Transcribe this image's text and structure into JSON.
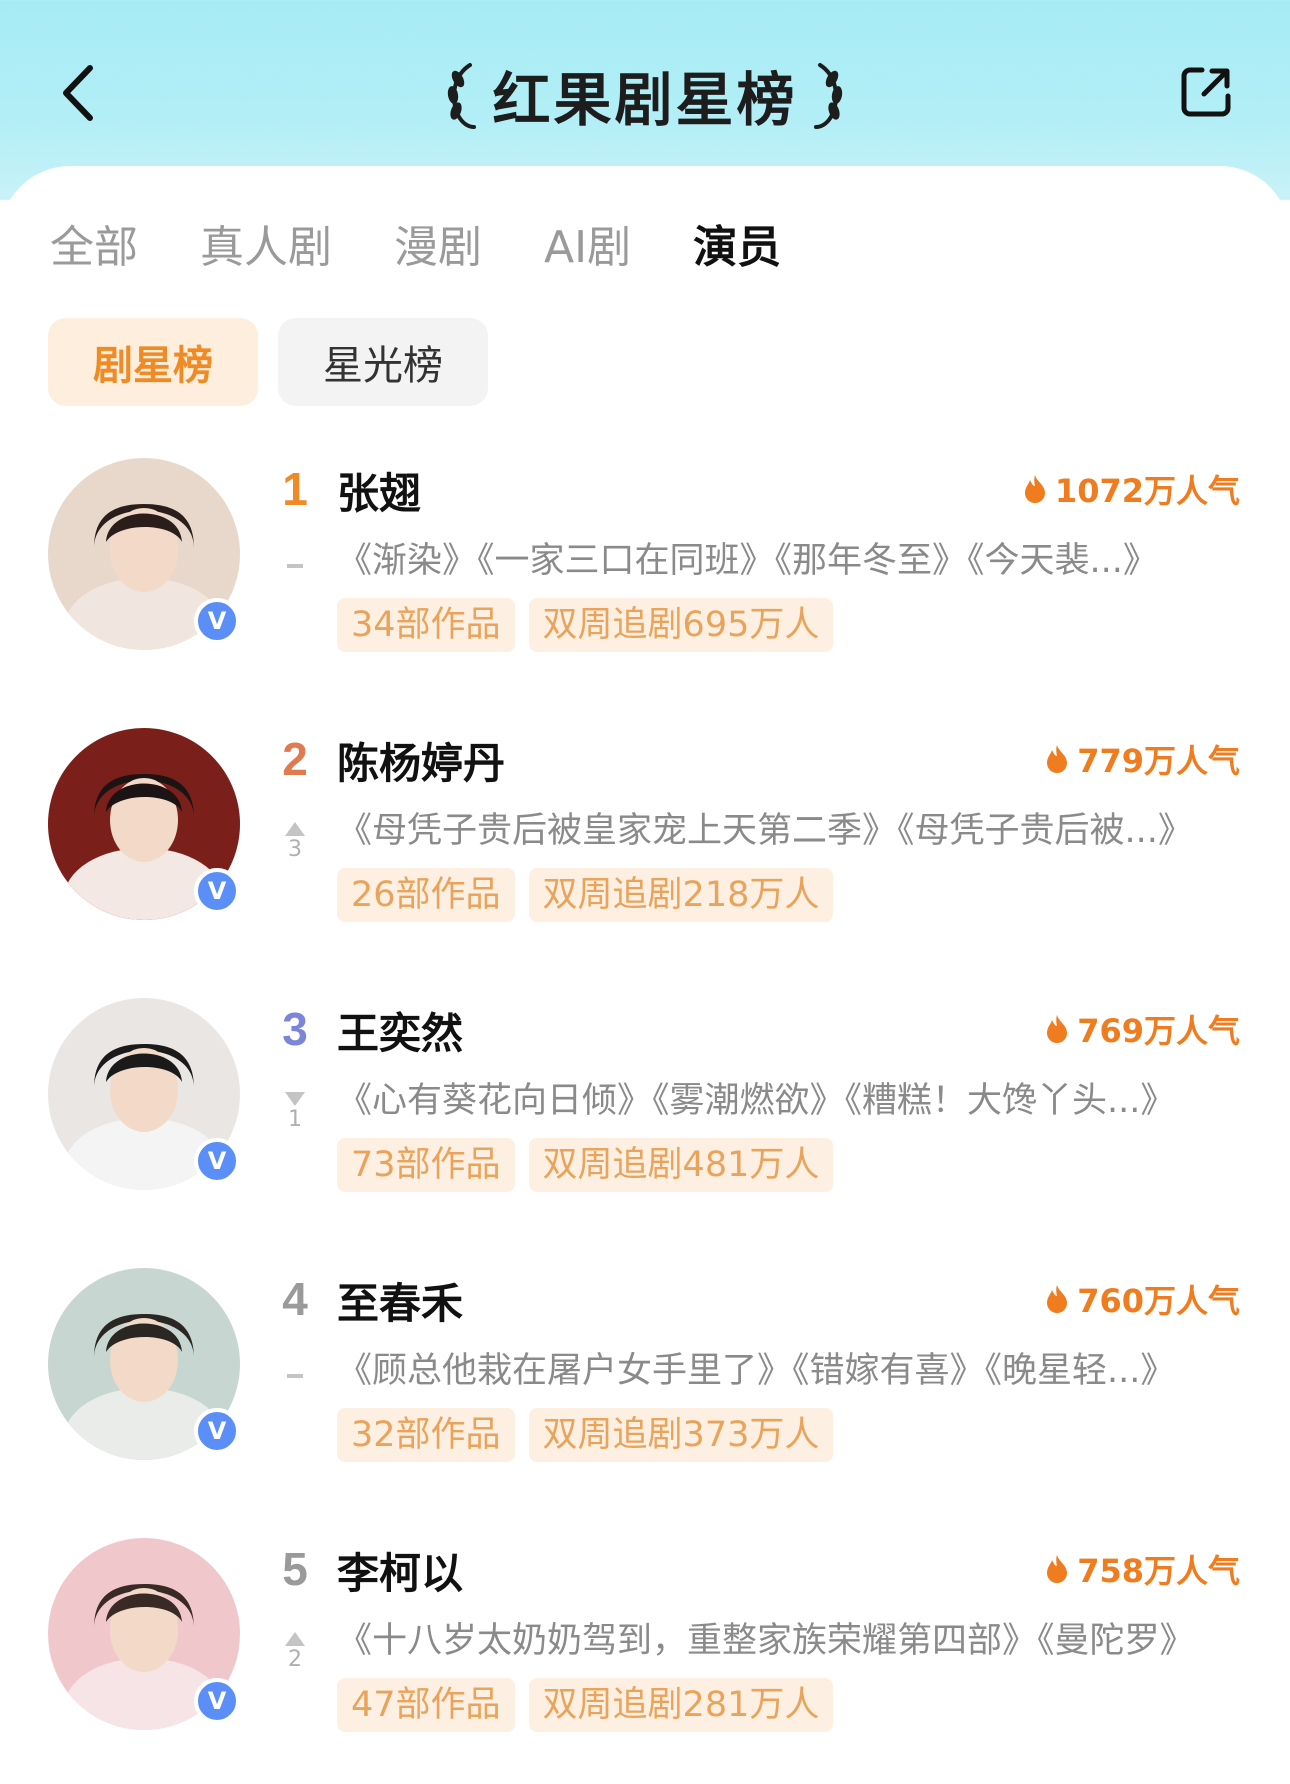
{
  "header": {
    "title": "红果剧星榜",
    "back_icon": "chevron-left-icon",
    "share_icon": "share-icon"
  },
  "tabs": [
    {
      "label": "全部",
      "active": false
    },
    {
      "label": "真人剧",
      "active": false
    },
    {
      "label": "漫剧",
      "active": false
    },
    {
      "label": "AI剧",
      "active": false
    },
    {
      "label": "演员",
      "active": true
    }
  ],
  "chips": [
    {
      "label": "剧星榜",
      "active": true
    },
    {
      "label": "星光榜",
      "active": false
    }
  ],
  "colors": {
    "accent": "#f07c20",
    "rank1": "#f08a24",
    "rank2": "#e07a50",
    "rank3": "#7c86d8",
    "rank_other": "#9a9a9a",
    "verified": "#5b8ff7"
  },
  "list": [
    {
      "rank": "1",
      "trend": "same",
      "trend_num": "",
      "name": "张翅",
      "popularity": "1072万人气",
      "works": "《渐染》《一家三口在同班》《那年冬至》《今天裴...》",
      "count": "34部作品",
      "follow": "双周追剧695万人",
      "verified": "V",
      "avatar_colors": [
        "#2b1e1a",
        "#f1e6df",
        "#e8d8cc"
      ]
    },
    {
      "rank": "2",
      "trend": "up",
      "trend_num": "3",
      "name": "陈杨婷丹",
      "popularity": "779万人气",
      "works": "《母凭子贵后被皇家宠上天第二季》《母凭子贵后被...》",
      "count": "26部作品",
      "follow": "双周追剧218万人",
      "verified": "V",
      "avatar_colors": [
        "#1c1414",
        "#f3e8e4",
        "#7a1f1a"
      ]
    },
    {
      "rank": "3",
      "trend": "down",
      "trend_num": "1",
      "name": "王奕然",
      "popularity": "769万人气",
      "works": "《心有葵花向日倾》《雾潮燃欲》《糟糕！大馋丫头...》",
      "count": "73部作品",
      "follow": "双周追剧481万人",
      "verified": "V",
      "avatar_colors": [
        "#1a1a1a",
        "#f4f4f4",
        "#eae6e4"
      ]
    },
    {
      "rank": "4",
      "trend": "same",
      "trend_num": "",
      "name": "至春禾",
      "popularity": "760万人气",
      "works": "《顾总他栽在屠户女手里了》《错嫁有喜》《晚星轻...》",
      "count": "32部作品",
      "follow": "双周追剧373万人",
      "verified": "V",
      "avatar_colors": [
        "#2a2622",
        "#e9ece8",
        "#c8d6d2"
      ]
    },
    {
      "rank": "5",
      "trend": "up",
      "trend_num": "2",
      "name": "李柯以",
      "popularity": "758万人气",
      "works": "《十八岁太奶奶驾到，重整家族荣耀第四部》《曼陀罗》",
      "count": "47部作品",
      "follow": "双周追剧281万人",
      "verified": "V",
      "avatar_colors": [
        "#3a2a26",
        "#f6e4e6",
        "#f0c8cc"
      ]
    }
  ]
}
